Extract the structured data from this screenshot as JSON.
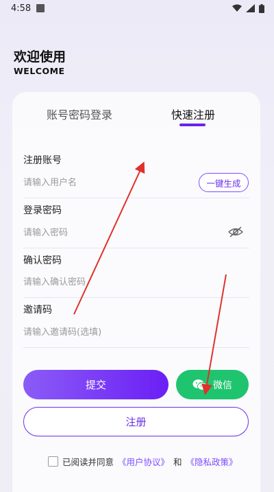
{
  "status_bar": {
    "time": "4:58"
  },
  "header": {
    "title": "欢迎使用",
    "subtitle": "WELCOME"
  },
  "tabs": [
    {
      "label": "账号密码登录",
      "active": false
    },
    {
      "label": "快速注册",
      "active": true
    }
  ],
  "form": {
    "account": {
      "label": "注册账号",
      "placeholder": "请输入用户名",
      "value": ""
    },
    "generate_label": "一键生成",
    "password": {
      "label": "登录密码",
      "placeholder": "请输入密码",
      "value": ""
    },
    "confirm": {
      "label": "确认密码",
      "placeholder": "请输入确认密码",
      "value": ""
    },
    "invite": {
      "label": "邀请码",
      "placeholder": "请输入邀请码(选填)",
      "value": ""
    }
  },
  "buttons": {
    "submit": "提交",
    "wechat": "微信",
    "register": "注册"
  },
  "agreement": {
    "prefix": "已阅读并同意",
    "user_agreement": "《用户协议》",
    "and": "和",
    "privacy_policy": "《隐私政策》",
    "checked": false
  },
  "icons": {
    "status_square": "notification-square-icon",
    "wifi": "wifi-icon",
    "signal": "signal-icon",
    "battery": "battery-icon",
    "eye": "eye-off-icon",
    "wechat": "wechat-icon"
  },
  "colors": {
    "accent": "#6a2ee8",
    "wechat_green": "#1fc46f",
    "annotation_arrow": "#e0302a"
  }
}
